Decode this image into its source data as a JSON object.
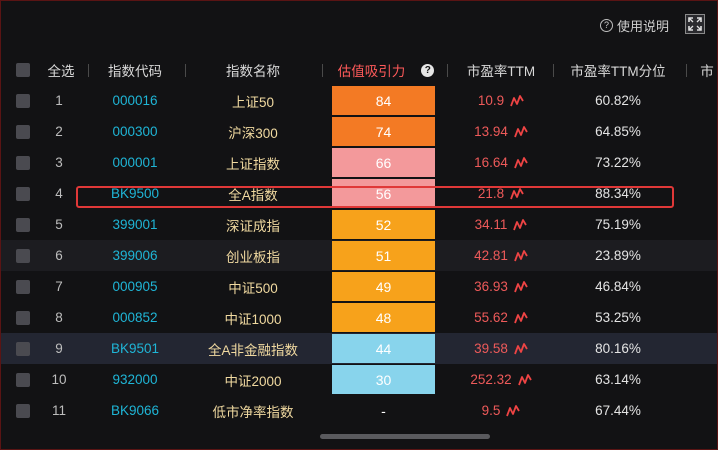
{
  "toolbar": {
    "help_label": "使用说明",
    "help_icon": "question-circle-icon",
    "fullscreen_icon": "fullscreen-icon"
  },
  "table": {
    "headers": {
      "select_all": "全选",
      "code": "指数代码",
      "name": "指数名称",
      "valuation": "估值吸引力",
      "pe": "市盈率TTM",
      "pe_pct": "市盈率TTM分位",
      "more": "市"
    },
    "colors": {
      "attraction_high": "#f37a24",
      "attraction_pink": "#f3999b",
      "attraction_orange": "#f7a21b",
      "attraction_blue": "#88d4ec",
      "code": "#1fb5d6",
      "name": "#f0d9a0",
      "pe": "#ee5a5a",
      "highlight_border": "#e03838"
    },
    "rows": [
      {
        "index": "1",
        "code": "000016",
        "name": "上证50",
        "valuation": "84",
        "val_color": "#f37a24",
        "pe": "10.9",
        "pct": "60.82%"
      },
      {
        "index": "2",
        "code": "000300",
        "name": "沪深300",
        "valuation": "74",
        "val_color": "#f37a24",
        "pe": "13.94",
        "pct": "64.85%"
      },
      {
        "index": "3",
        "code": "000001",
        "name": "上证指数",
        "valuation": "66",
        "val_color": "#f3999b",
        "pe": "16.64",
        "pct": "73.22%"
      },
      {
        "index": "4",
        "code": "BK9500",
        "name": "全A指数",
        "valuation": "56",
        "val_color": "#f3999b",
        "pe": "21.8",
        "pct": "88.34%"
      },
      {
        "index": "5",
        "code": "399001",
        "name": "深证成指",
        "valuation": "52",
        "val_color": "#f7a21b",
        "pe": "34.11",
        "pct": "75.19%"
      },
      {
        "index": "6",
        "code": "399006",
        "name": "创业板指",
        "valuation": "51",
        "val_color": "#f7a21b",
        "pe": "42.81",
        "pct": "23.89%"
      },
      {
        "index": "7",
        "code": "000905",
        "name": "中证500",
        "valuation": "49",
        "val_color": "#f7a21b",
        "pe": "36.93",
        "pct": "46.84%"
      },
      {
        "index": "8",
        "code": "000852",
        "name": "中证1000",
        "valuation": "48",
        "val_color": "#f7a21b",
        "pe": "55.62",
        "pct": "53.25%"
      },
      {
        "index": "9",
        "code": "BK9501",
        "name": "全A非金融指数",
        "valuation": "44",
        "val_color": "#88d4ec",
        "pe": "39.58",
        "pct": "80.16%"
      },
      {
        "index": "10",
        "code": "932000",
        "name": "中证2000",
        "valuation": "30",
        "val_color": "#88d4ec",
        "pe": "252.32",
        "pct": "63.14%"
      },
      {
        "index": "11",
        "code": "BK9066",
        "name": "低市净率指数",
        "valuation": "-",
        "val_color": "",
        "pe": "9.5",
        "pct": "67.44%"
      }
    ]
  }
}
